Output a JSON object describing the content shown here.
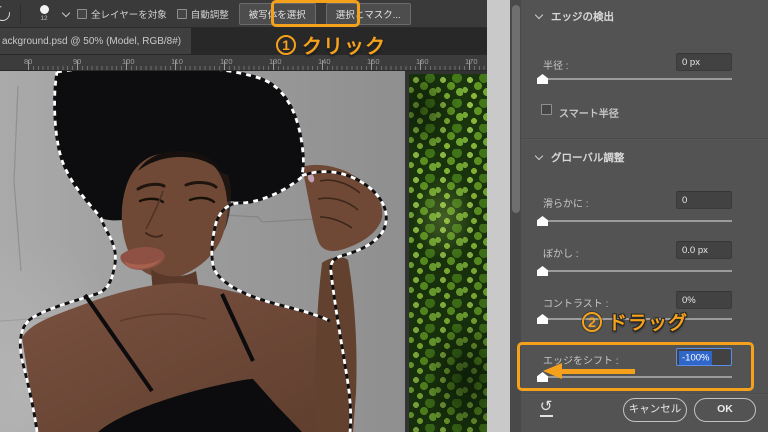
{
  "accent_color": "#F5A11C",
  "toolbar": {
    "brush_size": "12",
    "sample_all_layers_label": "全レイヤーを対象",
    "auto_enhance_label": "自動調整",
    "select_subject_label": "被写体を選択",
    "select_and_mask_label": "選択とマスク..."
  },
  "tab": {
    "title": "ackground.psd @ 50% (Model, RGB/8#)"
  },
  "ruler": {
    "numbers": [
      "80",
      "90",
      "100",
      "110",
      "120",
      "130",
      "140",
      "150",
      "160",
      "170"
    ]
  },
  "annotations": {
    "step1": {
      "num": "1",
      "label": "クリック"
    },
    "step2": {
      "num": "2",
      "label": "ドラッグ"
    }
  },
  "panel": {
    "edge_detection": {
      "header": "エッジの検出",
      "radius_label": "半径 :",
      "radius_value": "0 px",
      "smart_radius_label": "スマート半径"
    },
    "global_refine": {
      "header": "グローバル調整",
      "smooth": {
        "label": "滑らかに :",
        "value": "0"
      },
      "feather": {
        "label": "ぼかし :",
        "value": "0.0 px"
      },
      "contrast": {
        "label": "コントラスト :",
        "value": "0%"
      },
      "shift": {
        "label": "エッジをシフト :",
        "value": "-100%"
      }
    },
    "footer": {
      "cancel_label": "キャンセル",
      "ok_label": "OK"
    },
    "status_colors": {
      "selection_highlight": "#2e66c9",
      "panel_bg": "#535353"
    }
  }
}
